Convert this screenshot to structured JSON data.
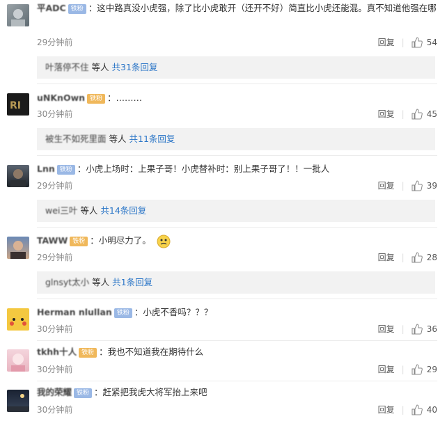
{
  "comments": [
    {
      "user": "平ADC",
      "badge": "铁粉",
      "badge_color": "blue",
      "text": "：这中路真没小虎强，除了比小虎敢开（还开不好）简直比小虎还能混。真不知道他强在哪",
      "time": "29分钟前",
      "reply": "回复",
      "likes": "54",
      "replies": {
        "users": "叶落停不住",
        "tail": "等人",
        "link": "共31条回复"
      }
    },
    {
      "user": "uNKnOwn",
      "badge": "铁粉",
      "badge_color": "gold",
      "text": "：………",
      "time": "30分钟前",
      "reply": "回复",
      "likes": "45",
      "replies": {
        "users": "被生不如死里面",
        "tail": "等人",
        "link": "共11条回复"
      }
    },
    {
      "user": "Lnn",
      "badge": "铁粉",
      "badge_color": "blue",
      "text": "：小虎上场时：上果子哥！小虎替补时：别上果子哥了！！一批人",
      "time": "29分钟前",
      "reply": "回复",
      "likes": "39",
      "replies": {
        "users": "wei三叶",
        "tail": "等人",
        "link": "共14条回复"
      }
    },
    {
      "user": "TAWW",
      "badge": "铁粉",
      "badge_color": "gold",
      "text": "：小明尽力了。",
      "time": "29分钟前",
      "reply": "回复",
      "likes": "28",
      "replies": {
        "users": "glnsyt太小",
        "tail": "等人",
        "link": "共1条回复"
      }
    },
    {
      "user": "Herman nlullan",
      "badge": "铁粉",
      "badge_color": "blue",
      "text": "：小虎不香吗？？？",
      "time": "30分钟前",
      "reply": "回复",
      "likes": "36"
    },
    {
      "user": "tkhh十人",
      "badge": "铁粉",
      "badge_color": "gold",
      "text": "：我也不知道我在期待什么",
      "time": "30分钟前",
      "reply": "回复",
      "likes": "29"
    },
    {
      "user": "我的荣耀",
      "badge": "铁粉",
      "badge_color": "blue",
      "text": "：赶紧把我虎大将军抬上来吧",
      "time": "30分钟前",
      "reply": "回复",
      "likes": "40"
    }
  ],
  "colors": {
    "link": "#2a75c7",
    "time": "#888888",
    "reply_bg": "#f2f2f2"
  }
}
